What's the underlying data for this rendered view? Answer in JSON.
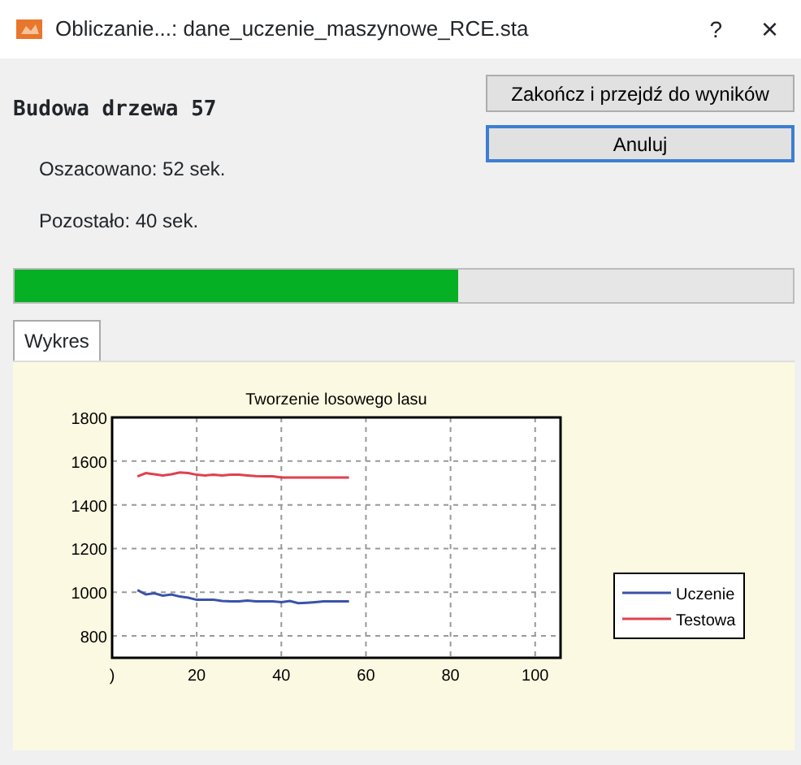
{
  "window": {
    "title": "Obliczanie...: dane_uczenie_maszynowe_RCE.sta",
    "help": "?",
    "close": "×"
  },
  "heading": "Budowa drzewa 57",
  "estimated": "Oszacowano: 52 sek.",
  "remaining": "Pozostało: 40 sek.",
  "buttons": [
    {
      "label": "Zakończ i przejdź do wyników",
      "selected": false
    },
    {
      "label": "Anuluj",
      "selected": true
    }
  ],
  "progress": {
    "level": 0.57
  },
  "tabs": [
    {
      "label": "Wykres",
      "selected": true
    }
  ],
  "chart_data": {
    "type": "line",
    "title": "Tworzenie losowego lasu",
    "x": [
      6,
      8,
      10,
      12,
      14,
      16,
      18,
      20,
      22,
      24,
      26,
      28,
      30,
      32,
      34,
      36,
      38,
      40,
      42,
      44,
      46,
      48,
      50,
      52,
      54,
      56
    ],
    "series": [
      {
        "name": "Uczenie",
        "color": "#3a52a8",
        "values": [
          1010,
          990,
          995,
          985,
          990,
          980,
          975,
          965,
          965,
          965,
          960,
          958,
          958,
          962,
          958,
          958,
          958,
          955,
          960,
          950,
          952,
          955,
          958,
          958,
          958,
          958
        ]
      },
      {
        "name": "Testowa",
        "color": "#e0404f",
        "values": [
          1530,
          1545,
          1540,
          1535,
          1540,
          1548,
          1545,
          1538,
          1535,
          1538,
          1535,
          1538,
          1538,
          1535,
          1532,
          1530,
          1530,
          1525,
          1525,
          1525,
          1525,
          1525,
          1525,
          1525,
          1525,
          1525
        ]
      }
    ],
    "xlim": [
      0,
      106
    ],
    "grid": true,
    "legend": true,
    "ylim": [
      700,
      1800
    ],
    "xticks": [
      {
        "value": 0,
        "label": ")"
      },
      20,
      40,
      60,
      80,
      100
    ],
    "yticks": [
      800,
      1000,
      1200,
      1400,
      1600,
      1800
    ]
  }
}
